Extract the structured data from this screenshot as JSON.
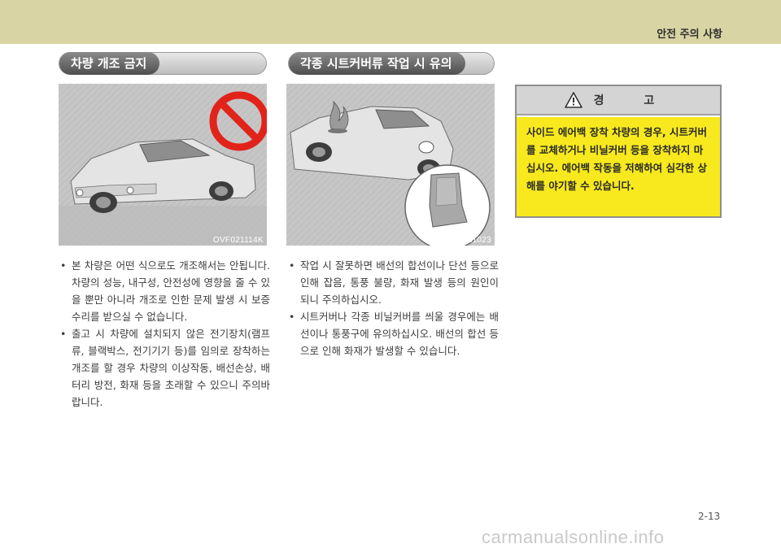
{
  "header": {
    "title": "안전 주의 사항"
  },
  "left_section": {
    "heading": "차량 개조 금지",
    "figure_code": "OVF021114K",
    "bullets": [
      "본 차량은 어떤 식으로도 개조해서는 안됩니다. 차량의 성능, 내구성, 안전성에 영향을 줄 수 있을 뿐만 아니라 개조로 인한 문제 발생 시 보증수리를 받으실 수 없습니다.",
      "출고 시 차량에 설치되지 않은 전기장치(램프류, 블랙박스, 전기기기 등)를 임의로 장착하는 개조를 할 경우 차량의 이상작동, 배선손상, 배터리 방전, 화재 등을 초래할 수 있으니 주의바랍니다."
    ]
  },
  "middle_section": {
    "heading": "각종 시트커버류 작업 시 유의",
    "figure_code": "1JBA1023",
    "bullets": [
      "작업 시 잘못하면 배선의 합선이나 단선 등으로 인해 잡음, 통풍 불량, 화재 발생 등의 원인이 되니 주의하십시오.",
      "시트커버나 각종 비닐커버를 씌울 경우에는 배선이나 통풍구에 유의하십시오. 배선의 합선 등으로 인해 화재가 발생할 수 있습니다."
    ]
  },
  "warning_box": {
    "title": "경 고",
    "body": "사이드 에어백 장착 차량의 경우, 시트커버를 교체하거나 비닐커버 등을 장착하지 마십시오. 에어백 작동을 저해하여 심각한 상해를 야기할 수 있습니다.",
    "colors": {
      "body_bg": "#f7e91d",
      "header_bg": "#d4d4d4"
    }
  },
  "footer": {
    "page_number": "2-13",
    "watermark": "carmanualsonline.info"
  },
  "colors": {
    "top_bar": "#d9d4a3",
    "prohibit_sign": "#e2231a"
  }
}
